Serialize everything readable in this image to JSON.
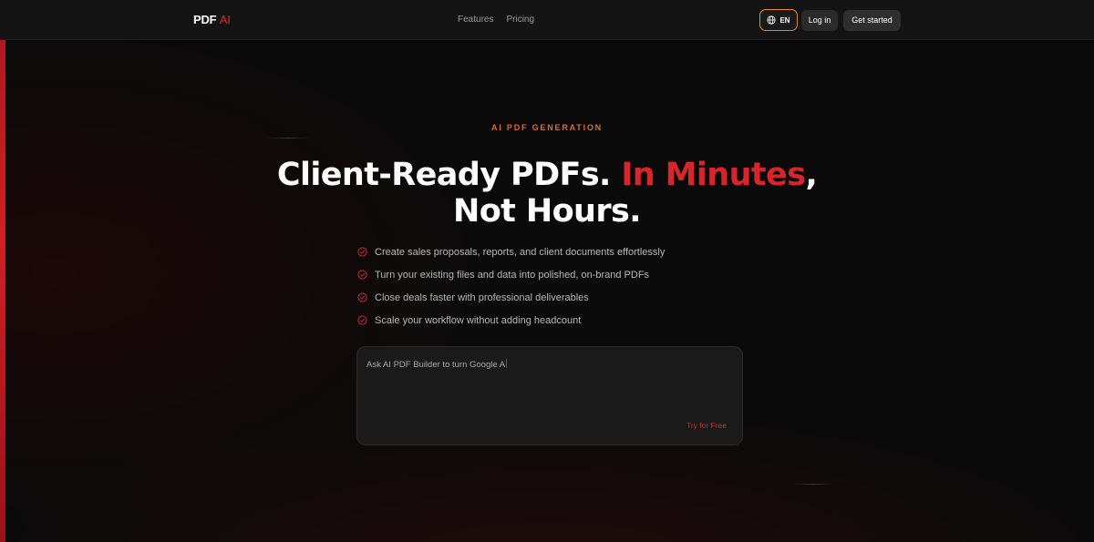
{
  "navbar": {
    "logo_main": "PDF",
    "logo_accent": "AI",
    "links": [
      "Features",
      "Pricing"
    ],
    "language_label": "EN",
    "login_label": "Log in",
    "get_started_label": "Get started"
  },
  "hero": {
    "eyebrow": "AI PDF GENERATION",
    "headline_part1": "Client-Ready PDFs. ",
    "headline_accent": "In Minutes",
    "headline_part2": ",",
    "headline_line2": "Not Hours.",
    "features": [
      "Create sales proposals, reports, and client documents effortlessly",
      "Turn your existing files and data into polished, on-brand PDFs",
      "Close deals faster with professional deliverables",
      "Scale your workflow without adding headcount"
    ]
  },
  "prompt": {
    "text": "Ask AI PDF Builder to turn Google A",
    "cta_label": "Try for Free"
  },
  "colors": {
    "accent_red": "#d8252b",
    "eyebrow_orange": "#e06a2e",
    "lang_border": "#e8852a",
    "background": "#0a0a0a"
  },
  "icons": {
    "language": "globe-icon",
    "feature_bullet": "check-circle-icon"
  }
}
